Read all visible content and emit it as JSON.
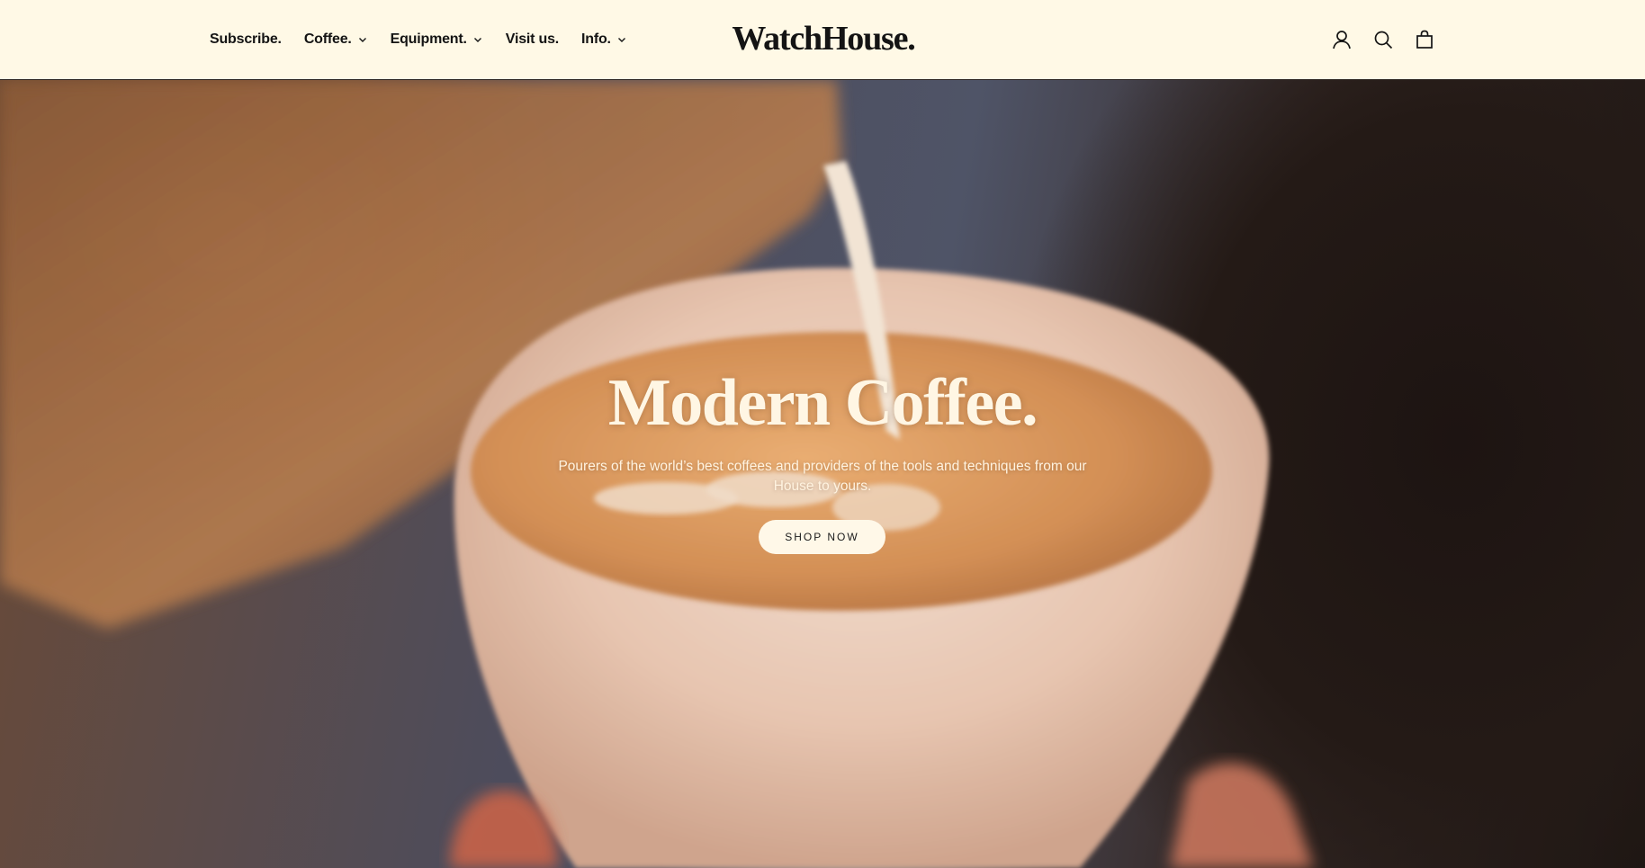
{
  "nav": {
    "items": [
      {
        "label": "Subscribe.",
        "dropdown": false
      },
      {
        "label": "Coffee.",
        "dropdown": true
      },
      {
        "label": "Equipment.",
        "dropdown": true
      },
      {
        "label": "Visit us.",
        "dropdown": false
      },
      {
        "label": "Info.",
        "dropdown": true
      }
    ]
  },
  "logo": {
    "text": "WatchHouse."
  },
  "icons": [
    "account-icon",
    "search-icon",
    "bag-icon"
  ],
  "hero": {
    "title": "Modern Coffee.",
    "subtitle": "Pourers of the world’s best coffees and providers of the tools and techniques from our House to yours.",
    "cta_label": "SHOP NOW"
  },
  "colors": {
    "header_bg": "#fff9e6",
    "text_dark": "#141414",
    "hero_text": "#fff6e4",
    "button_bg": "#fff8e8"
  }
}
